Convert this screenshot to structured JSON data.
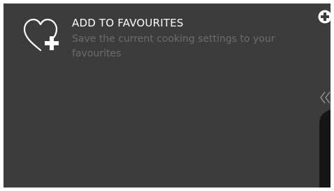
{
  "favourites": {
    "title": "ADD TO FAVOURITES",
    "description": "Save the current cooking settings to your favourites",
    "icon": "heart-plus-icon"
  },
  "corner_action": {
    "icon": "plus-circle-icon"
  },
  "side_panel": {
    "handle_icon": "double-chevron-left-icon"
  },
  "colors": {
    "background": "#3c3c3c",
    "title": "#ffffff",
    "description": "#6c6c6c",
    "panel": "#161616"
  }
}
